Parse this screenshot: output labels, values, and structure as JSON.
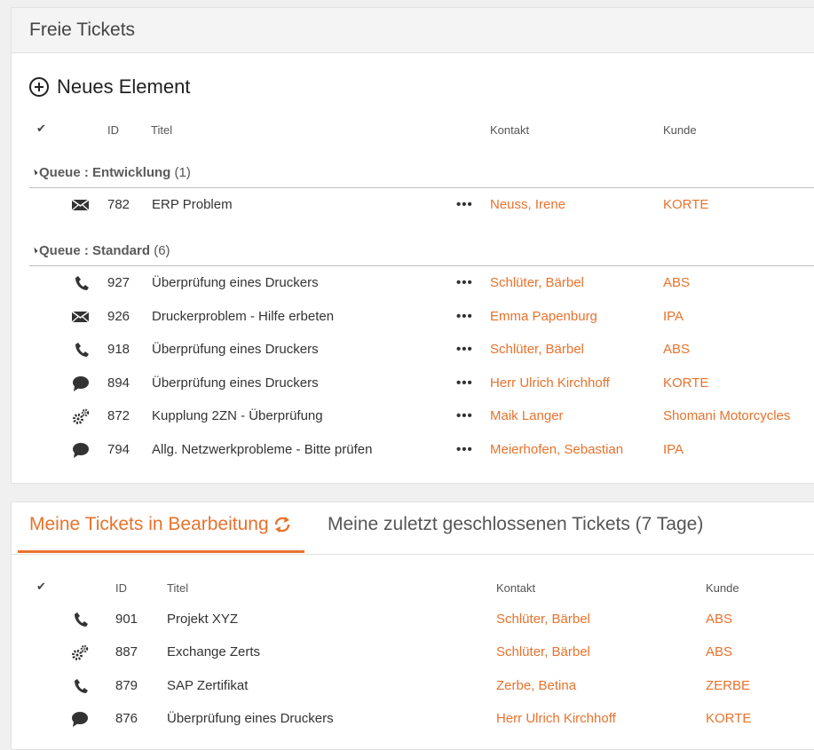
{
  "panel1": {
    "title": "Freie Tickets",
    "new_item_label": "Neues Element",
    "columns": {
      "check": "✔",
      "id": "ID",
      "title": "Titel",
      "contact": "Kontakt",
      "customer": "Kunde"
    },
    "groups": [
      {
        "label": "Queue : Entwicklung",
        "count": "(1)",
        "rows": [
          {
            "icon": "mail-icon",
            "id": "782",
            "title": "ERP Problem",
            "contact": "Neuss, Irene",
            "customer": "KORTE"
          }
        ]
      },
      {
        "label": "Queue : Standard",
        "count": "(6)",
        "rows": [
          {
            "icon": "phone-icon",
            "id": "927",
            "title": "Überprüfung eines Druckers",
            "contact": "Schlüter, Bärbel",
            "customer": "ABS"
          },
          {
            "icon": "mail-icon",
            "id": "926",
            "title": "Druckerproblem - Hilfe erbeten",
            "contact": "Emma Papenburg",
            "customer": "IPA"
          },
          {
            "icon": "phone-icon",
            "id": "918",
            "title": "Überprüfung eines Druckers",
            "contact": "Schlüter, Bärbel",
            "customer": "ABS"
          },
          {
            "icon": "chat-icon",
            "id": "894",
            "title": "Überprüfung eines Druckers",
            "contact": "Herr Ulrich Kirchhoff",
            "customer": "KORTE"
          },
          {
            "icon": "gears-icon",
            "id": "872",
            "title": "Kupplung 2ZN - Überprüfung",
            "contact": "Maik Langer",
            "customer": "Shomani Motorcycles"
          },
          {
            "icon": "chat-icon",
            "id": "794",
            "title": "Allg. Netzwerkprobleme - Bitte prüfen",
            "contact": "Meierhofen, Sebastian",
            "customer": "IPA"
          }
        ]
      }
    ],
    "row_menu": "•••"
  },
  "panel2": {
    "tabs": [
      {
        "label": "Meine Tickets in Bearbeitung",
        "active": true
      },
      {
        "label": "Meine zuletzt geschlossenen Tickets (7 Tage)",
        "active": false
      }
    ],
    "columns": {
      "check": "✔",
      "id": "ID",
      "title": "Titel",
      "contact": "Kontakt",
      "customer": "Kunde"
    },
    "rows": [
      {
        "icon": "phone-icon",
        "id": "901",
        "title": "Projekt XYZ",
        "contact": "Schlüter, Bärbel",
        "customer": "ABS"
      },
      {
        "icon": "gears-icon",
        "id": "887",
        "title": "Exchange Zerts",
        "contact": "Schlüter, Bärbel",
        "customer": "ABS"
      },
      {
        "icon": "phone-icon",
        "id": "879",
        "title": "SAP Zertifikat",
        "contact": "Zerbe, Betina",
        "customer": "ZERBE"
      },
      {
        "icon": "chat-icon",
        "id": "876",
        "title": "Überprüfung eines Druckers",
        "contact": "Herr Ulrich Kirchhoff",
        "customer": "KORTE"
      }
    ]
  },
  "colors": {
    "accent": "#e8722c",
    "text": "#333333",
    "header_bg": "#f4f4f4"
  }
}
